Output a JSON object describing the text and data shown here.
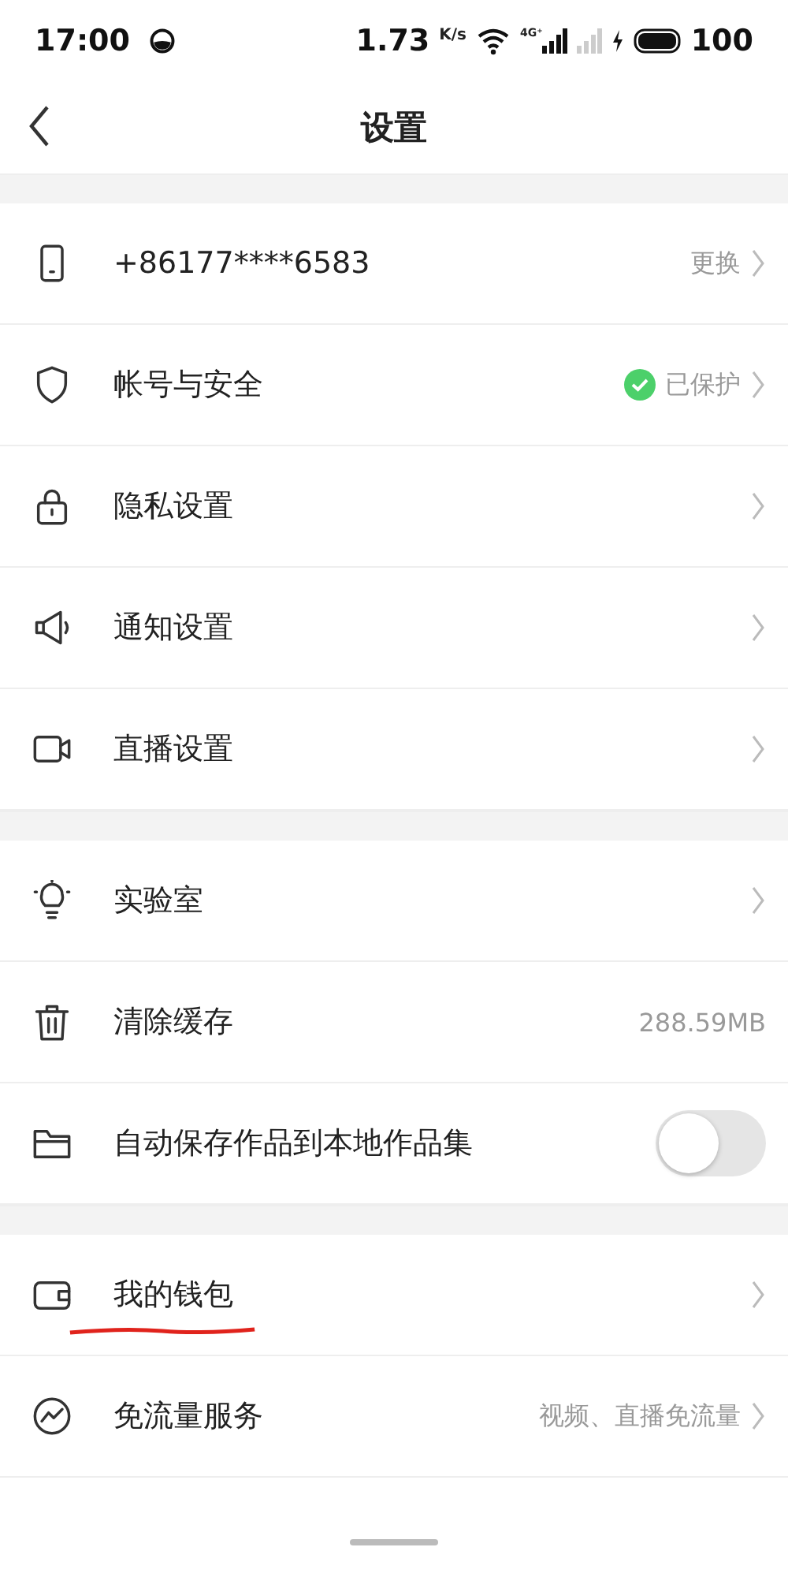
{
  "status_bar": {
    "time": "17:00",
    "speed": "1.73",
    "speed_unit": "K/s",
    "network": "4G⁺",
    "battery": "100"
  },
  "header": {
    "title": "设置"
  },
  "sections": [
    {
      "rows": [
        {
          "kind": "link",
          "label": "+86177****6583",
          "value": "更换"
        },
        {
          "kind": "link",
          "label": "帐号与安全",
          "value": "已保护",
          "verified": true
        },
        {
          "kind": "link",
          "label": "隐私设置"
        },
        {
          "kind": "link",
          "label": "通知设置"
        },
        {
          "kind": "link",
          "label": "直播设置"
        }
      ]
    },
    {
      "rows": [
        {
          "kind": "link",
          "label": "实验室"
        },
        {
          "kind": "value",
          "label": "清除缓存",
          "value": "288.59MB"
        },
        {
          "kind": "toggle",
          "label": "自动保存作品到本地作品集",
          "on": false
        }
      ]
    },
    {
      "rows": [
        {
          "kind": "link",
          "label": "我的钱包",
          "underlined": true
        },
        {
          "kind": "link",
          "label": "免流量服务",
          "value": "视频、直播免流量"
        }
      ]
    }
  ]
}
